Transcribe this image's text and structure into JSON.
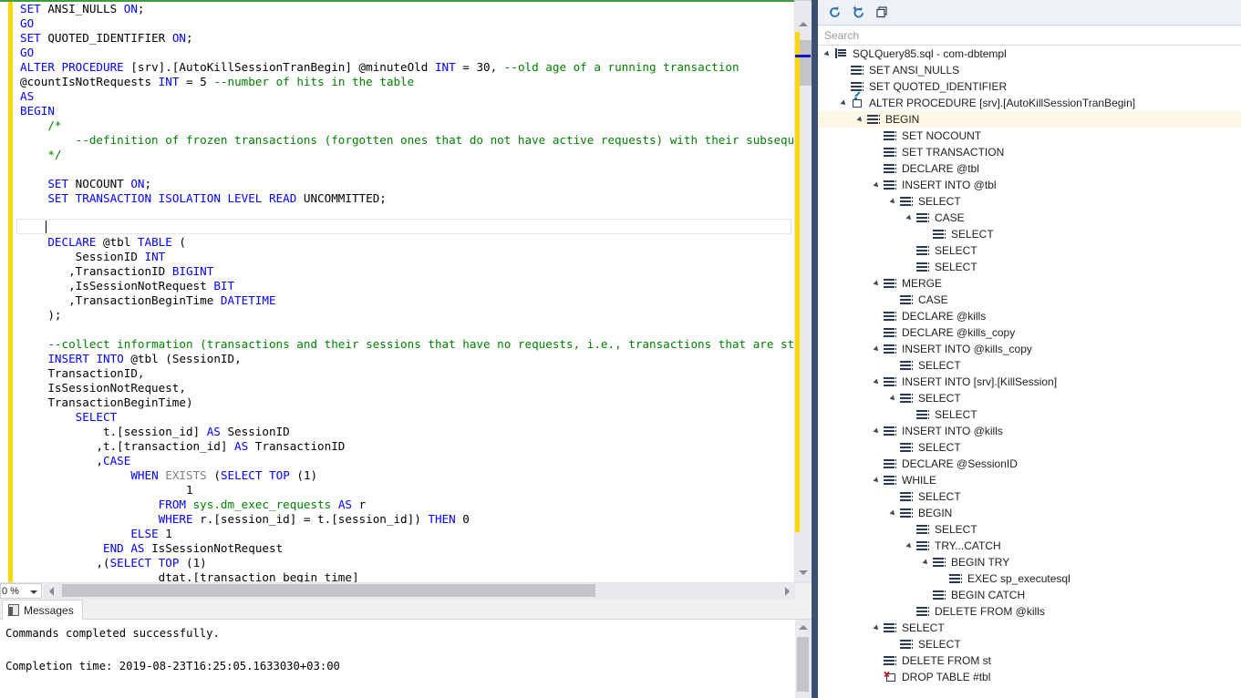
{
  "colors": {
    "keyword": "#0000ff",
    "comment": "#008000",
    "gray_keyword": "#808080",
    "accent_panel_border": "#3d4f73",
    "selection_highlight": "#fdf8e3",
    "change_margin": "#ffd700",
    "editor_top_border": "#3f9d3f"
  },
  "editor": {
    "zoom_level": "0 %",
    "code_lines": [
      [
        {
          "t": "SET",
          "c": "kw"
        },
        {
          "t": " ANSI_NULLS ",
          "c": "blk"
        },
        {
          "t": "ON",
          "c": "kw"
        },
        {
          "t": ";",
          "c": "blk"
        }
      ],
      [
        {
          "t": "GO",
          "c": "kw"
        }
      ],
      [
        {
          "t": "SET",
          "c": "kw"
        },
        {
          "t": " QUOTED_IDENTIFIER ",
          "c": "blk"
        },
        {
          "t": "ON",
          "c": "kw"
        },
        {
          "t": ";",
          "c": "blk"
        }
      ],
      [
        {
          "t": "GO",
          "c": "kw"
        }
      ],
      [
        {
          "t": "ALTER PROCEDURE",
          "c": "kw"
        },
        {
          "t": " [srv].[AutoKillSessionTranBegin] @minuteOld ",
          "c": "blk"
        },
        {
          "t": "INT",
          "c": "kw"
        },
        {
          "t": " = ",
          "c": "blk"
        },
        {
          "t": "30",
          "c": "blk"
        },
        {
          "t": ", ",
          "c": "blk"
        },
        {
          "t": "--old age of a running transaction",
          "c": "cmt"
        }
      ],
      [
        {
          "t": "@countIsNotRequests ",
          "c": "blk"
        },
        {
          "t": "INT",
          "c": "kw"
        },
        {
          "t": " = ",
          "c": "blk"
        },
        {
          "t": "5",
          "c": "blk"
        },
        {
          "t": " ",
          "c": "blk"
        },
        {
          "t": "--number of hits in the table",
          "c": "cmt"
        }
      ],
      [
        {
          "t": "AS",
          "c": "kw"
        }
      ],
      [
        {
          "t": "BEGIN",
          "c": "kw"
        }
      ],
      [
        {
          "t": "    ",
          "c": "blk"
        },
        {
          "t": "/*",
          "c": "cmt"
        }
      ],
      [
        {
          "t": "        --definition of frozen transactions (forgotten ones that do not have active requests) with their subsequent remova",
          "c": "cmt"
        }
      ],
      [
        {
          "t": "    ",
          "c": "blk"
        },
        {
          "t": "*/",
          "c": "cmt"
        }
      ],
      [
        {
          "t": "",
          "c": "blk"
        }
      ],
      [
        {
          "t": "    ",
          "c": "blk"
        },
        {
          "t": "SET",
          "c": "kw"
        },
        {
          "t": " NOCOUNT ",
          "c": "blk"
        },
        {
          "t": "ON",
          "c": "kw"
        },
        {
          "t": ";",
          "c": "blk"
        }
      ],
      [
        {
          "t": "    ",
          "c": "blk"
        },
        {
          "t": "SET TRANSACTION ISOLATION LEVEL READ",
          "c": "kw"
        },
        {
          "t": " UNCOMMITTED;",
          "c": "blk"
        }
      ],
      [
        {
          "t": "",
          "c": "blk"
        }
      ],
      [
        {
          "t": "",
          "c": "blk"
        }
      ],
      [
        {
          "t": "    ",
          "c": "blk"
        },
        {
          "t": "DECLARE",
          "c": "kw"
        },
        {
          "t": " @tbl ",
          "c": "blk"
        },
        {
          "t": "TABLE",
          "c": "kw"
        },
        {
          "t": " (",
          "c": "blk"
        }
      ],
      [
        {
          "t": "        SessionID ",
          "c": "blk"
        },
        {
          "t": "INT",
          "c": "kw"
        }
      ],
      [
        {
          "t": "       ,TransactionID ",
          "c": "blk"
        },
        {
          "t": "BIGINT",
          "c": "kw"
        }
      ],
      [
        {
          "t": "       ,IsSessionNotRequest ",
          "c": "blk"
        },
        {
          "t": "BIT",
          "c": "kw"
        }
      ],
      [
        {
          "t": "       ,TransactionBeginTime ",
          "c": "blk"
        },
        {
          "t": "DATETIME",
          "c": "kw"
        }
      ],
      [
        {
          "t": "    );",
          "c": "blk"
        }
      ],
      [
        {
          "t": "",
          "c": "blk"
        }
      ],
      [
        {
          "t": "    ",
          "c": "blk"
        },
        {
          "t": "--collect information (transactions and their sessions that have no requests, i.e., transactions that are started and",
          "c": "cmt"
        }
      ],
      [
        {
          "t": "    ",
          "c": "blk"
        },
        {
          "t": "INSERT",
          "c": "kw"
        },
        {
          "t": " ",
          "c": "blk"
        },
        {
          "t": "INTO",
          "c": "kw"
        },
        {
          "t": " @tbl (SessionID,",
          "c": "blk"
        }
      ],
      [
        {
          "t": "    TransactionID,",
          "c": "blk"
        }
      ],
      [
        {
          "t": "    IsSessionNotRequest,",
          "c": "blk"
        }
      ],
      [
        {
          "t": "    TransactionBeginTime)",
          "c": "blk"
        }
      ],
      [
        {
          "t": "        ",
          "c": "blk"
        },
        {
          "t": "SELECT",
          "c": "kw"
        }
      ],
      [
        {
          "t": "            t.[session_id] ",
          "c": "blk"
        },
        {
          "t": "AS",
          "c": "kw"
        },
        {
          "t": " SessionID",
          "c": "blk"
        }
      ],
      [
        {
          "t": "           ,t.[transaction_id] ",
          "c": "blk"
        },
        {
          "t": "AS",
          "c": "kw"
        },
        {
          "t": " TransactionID",
          "c": "blk"
        }
      ],
      [
        {
          "t": "           ,",
          "c": "blk"
        },
        {
          "t": "CASE",
          "c": "kw"
        }
      ],
      [
        {
          "t": "                ",
          "c": "blk"
        },
        {
          "t": "WHEN",
          "c": "kw"
        },
        {
          "t": " ",
          "c": "blk"
        },
        {
          "t": "EXISTS",
          "c": "gray"
        },
        {
          "t": " (",
          "c": "blk"
        },
        {
          "t": "SELECT",
          "c": "kw"
        },
        {
          "t": " ",
          "c": "blk"
        },
        {
          "t": "TOP",
          "c": "kw"
        },
        {
          "t": " (1)",
          "c": "blk"
        }
      ],
      [
        {
          "t": "                        1",
          "c": "blk"
        }
      ],
      [
        {
          "t": "                    ",
          "c": "blk"
        },
        {
          "t": "FROM",
          "c": "kw"
        },
        {
          "t": " ",
          "c": "blk"
        },
        {
          "t": "sys.dm_exec_requests",
          "c": "cmt"
        },
        {
          "t": " ",
          "c": "blk"
        },
        {
          "t": "AS",
          "c": "kw"
        },
        {
          "t": " r",
          "c": "blk"
        }
      ],
      [
        {
          "t": "                    ",
          "c": "blk"
        },
        {
          "t": "WHERE",
          "c": "kw"
        },
        {
          "t": " r.[session_id] = t.[session_id]) ",
          "c": "blk"
        },
        {
          "t": "THEN",
          "c": "kw"
        },
        {
          "t": " 0",
          "c": "blk"
        }
      ],
      [
        {
          "t": "                ",
          "c": "blk"
        },
        {
          "t": "ELSE",
          "c": "kw"
        },
        {
          "t": " 1",
          "c": "blk"
        }
      ],
      [
        {
          "t": "            ",
          "c": "blk"
        },
        {
          "t": "END",
          "c": "kw"
        },
        {
          "t": " ",
          "c": "blk"
        },
        {
          "t": "AS",
          "c": "kw"
        },
        {
          "t": " IsSessionNotRequest",
          "c": "blk"
        }
      ],
      [
        {
          "t": "           ,(",
          "c": "blk"
        },
        {
          "t": "SELECT",
          "c": "kw"
        },
        {
          "t": " ",
          "c": "blk"
        },
        {
          "t": "TOP",
          "c": "kw"
        },
        {
          "t": " (1)",
          "c": "blk"
        }
      ],
      [
        {
          "t": "                    dtat.[transaction begin time]",
          "c": "blk"
        }
      ]
    ]
  },
  "messages": {
    "tab_label": "Messages",
    "body": "Commands completed successfully.\n\nCompletion time: 2019-08-23T16:25:05.1633030+03:00"
  },
  "outline": {
    "toolbar": [
      {
        "name": "refresh-icon",
        "label": "Refresh"
      },
      {
        "name": "auto-refresh-icon",
        "label": "Auto Refresh"
      },
      {
        "name": "windows-icon",
        "label": "Windows"
      }
    ],
    "search_placeholder": "Search",
    "search_value": "",
    "tree": [
      {
        "depth": 0,
        "twisty": "open",
        "icon": "doc",
        "label": "SQLQuery85.sql - com-dbtempl",
        "selected": false
      },
      {
        "depth": 1,
        "twisty": "none",
        "icon": "stmt",
        "label": "SET ANSI_NULLS",
        "selected": false
      },
      {
        "depth": 1,
        "twisty": "none",
        "icon": "stmt",
        "label": "SET QUOTED_IDENTIFIER",
        "selected": false
      },
      {
        "depth": 1,
        "twisty": "open",
        "icon": "proc",
        "label": "ALTER PROCEDURE [srv].[AutoKillSessionTranBegin]",
        "selected": false
      },
      {
        "depth": 2,
        "twisty": "open",
        "icon": "stmt",
        "label": "BEGIN",
        "selected": true
      },
      {
        "depth": 3,
        "twisty": "none",
        "icon": "stmt",
        "label": "SET NOCOUNT",
        "selected": false
      },
      {
        "depth": 3,
        "twisty": "none",
        "icon": "stmt",
        "label": "SET TRANSACTION",
        "selected": false
      },
      {
        "depth": 3,
        "twisty": "none",
        "icon": "stmt",
        "label": "DECLARE @tbl",
        "selected": false
      },
      {
        "depth": 3,
        "twisty": "open",
        "icon": "stmt",
        "label": "INSERT INTO @tbl",
        "selected": false
      },
      {
        "depth": 4,
        "twisty": "open",
        "icon": "stmt",
        "label": "SELECT",
        "selected": false
      },
      {
        "depth": 5,
        "twisty": "open",
        "icon": "stmt",
        "label": "CASE",
        "selected": false
      },
      {
        "depth": 6,
        "twisty": "none",
        "icon": "stmt",
        "label": "SELECT",
        "selected": false
      },
      {
        "depth": 5,
        "twisty": "none",
        "icon": "stmt",
        "label": "SELECT",
        "selected": false
      },
      {
        "depth": 5,
        "twisty": "none",
        "icon": "stmt",
        "label": "SELECT",
        "selected": false
      },
      {
        "depth": 3,
        "twisty": "open",
        "icon": "stmt",
        "label": "MERGE",
        "selected": false
      },
      {
        "depth": 4,
        "twisty": "none",
        "icon": "stmt",
        "label": "CASE",
        "selected": false
      },
      {
        "depth": 3,
        "twisty": "none",
        "icon": "stmt",
        "label": "DECLARE @kills",
        "selected": false
      },
      {
        "depth": 3,
        "twisty": "none",
        "icon": "stmt",
        "label": "DECLARE @kills_copy",
        "selected": false
      },
      {
        "depth": 3,
        "twisty": "open",
        "icon": "stmt",
        "label": "INSERT INTO @kills_copy",
        "selected": false
      },
      {
        "depth": 4,
        "twisty": "none",
        "icon": "stmt",
        "label": "SELECT",
        "selected": false
      },
      {
        "depth": 3,
        "twisty": "open",
        "icon": "stmt",
        "label": "INSERT INTO [srv].[KillSession]",
        "selected": false
      },
      {
        "depth": 4,
        "twisty": "open",
        "icon": "stmt",
        "label": "SELECT",
        "selected": false
      },
      {
        "depth": 5,
        "twisty": "none",
        "icon": "stmt",
        "label": "SELECT",
        "selected": false
      },
      {
        "depth": 3,
        "twisty": "open",
        "icon": "stmt",
        "label": "INSERT INTO @kills",
        "selected": false
      },
      {
        "depth": 4,
        "twisty": "none",
        "icon": "stmt",
        "label": "SELECT",
        "selected": false
      },
      {
        "depth": 3,
        "twisty": "none",
        "icon": "stmt",
        "label": "DECLARE @SessionID",
        "selected": false
      },
      {
        "depth": 3,
        "twisty": "open",
        "icon": "stmt",
        "label": "WHILE",
        "selected": false
      },
      {
        "depth": 4,
        "twisty": "none",
        "icon": "stmt",
        "label": "SELECT",
        "selected": false
      },
      {
        "depth": 4,
        "twisty": "open",
        "icon": "stmt",
        "label": "BEGIN",
        "selected": false
      },
      {
        "depth": 5,
        "twisty": "none",
        "icon": "stmt",
        "label": "SELECT",
        "selected": false
      },
      {
        "depth": 5,
        "twisty": "open",
        "icon": "stmt",
        "label": "TRY...CATCH",
        "selected": false
      },
      {
        "depth": 6,
        "twisty": "open",
        "icon": "stmt",
        "label": "BEGIN TRY",
        "selected": false
      },
      {
        "depth": 7,
        "twisty": "none",
        "icon": "stmt",
        "label": "EXEC sp_executesql",
        "selected": false
      },
      {
        "depth": 6,
        "twisty": "none",
        "icon": "stmt",
        "label": "BEGIN CATCH",
        "selected": false
      },
      {
        "depth": 5,
        "twisty": "none",
        "icon": "stmt",
        "label": "DELETE FROM @kills",
        "selected": false
      },
      {
        "depth": 3,
        "twisty": "open",
        "icon": "stmt",
        "label": "SELECT",
        "selected": false
      },
      {
        "depth": 4,
        "twisty": "none",
        "icon": "stmt",
        "label": "SELECT",
        "selected": false
      },
      {
        "depth": 3,
        "twisty": "none",
        "icon": "stmt",
        "label": "DELETE FROM st",
        "selected": false
      },
      {
        "depth": 3,
        "twisty": "none",
        "icon": "drop",
        "label": "DROP TABLE #tbl",
        "selected": false
      }
    ]
  }
}
